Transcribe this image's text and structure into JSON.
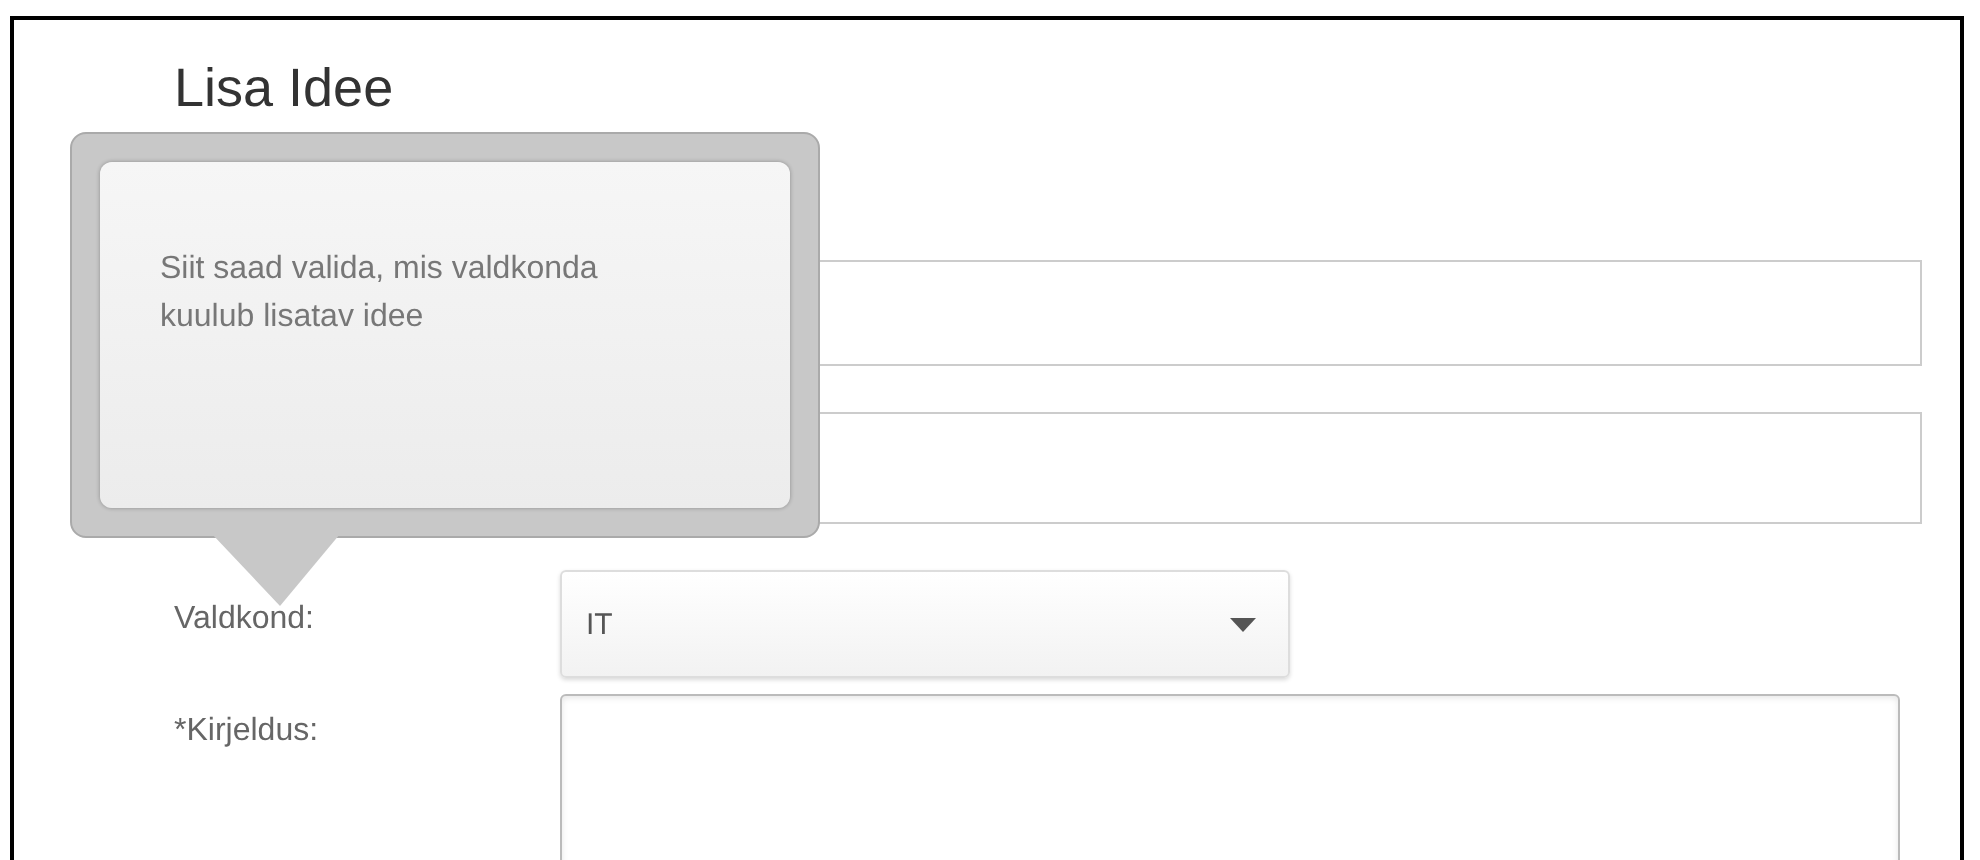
{
  "title": "Lisa Idee",
  "fields": [
    {
      "kind": "text"
    },
    {
      "kind": "text"
    },
    {
      "kind": "select",
      "label": "Valdkond:",
      "value": "IT"
    },
    {
      "kind": "textarea",
      "label": "*Kirjeldus:"
    }
  ],
  "tooltip": {
    "text": "Siit saad valida, mis valdkonda kuulub lisatav idee"
  }
}
